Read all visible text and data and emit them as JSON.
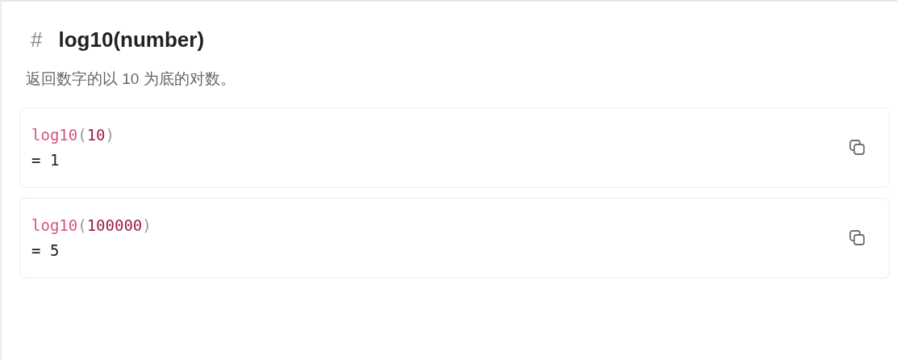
{
  "heading": {
    "mark": "#",
    "title": "log10(number)"
  },
  "description": "返回数字的以 10 为底的对数。",
  "examples": [
    {
      "tokens": [
        {
          "kind": "fn",
          "text": "log10"
        },
        {
          "kind": "punct",
          "text": "("
        },
        {
          "kind": "num",
          "text": "10"
        },
        {
          "kind": "punct",
          "text": ")"
        }
      ],
      "result": "= 1"
    },
    {
      "tokens": [
        {
          "kind": "fn",
          "text": "log10"
        },
        {
          "kind": "punct",
          "text": "("
        },
        {
          "kind": "num",
          "text": "100000"
        },
        {
          "kind": "punct",
          "text": ")"
        }
      ],
      "result": "= 5"
    }
  ]
}
